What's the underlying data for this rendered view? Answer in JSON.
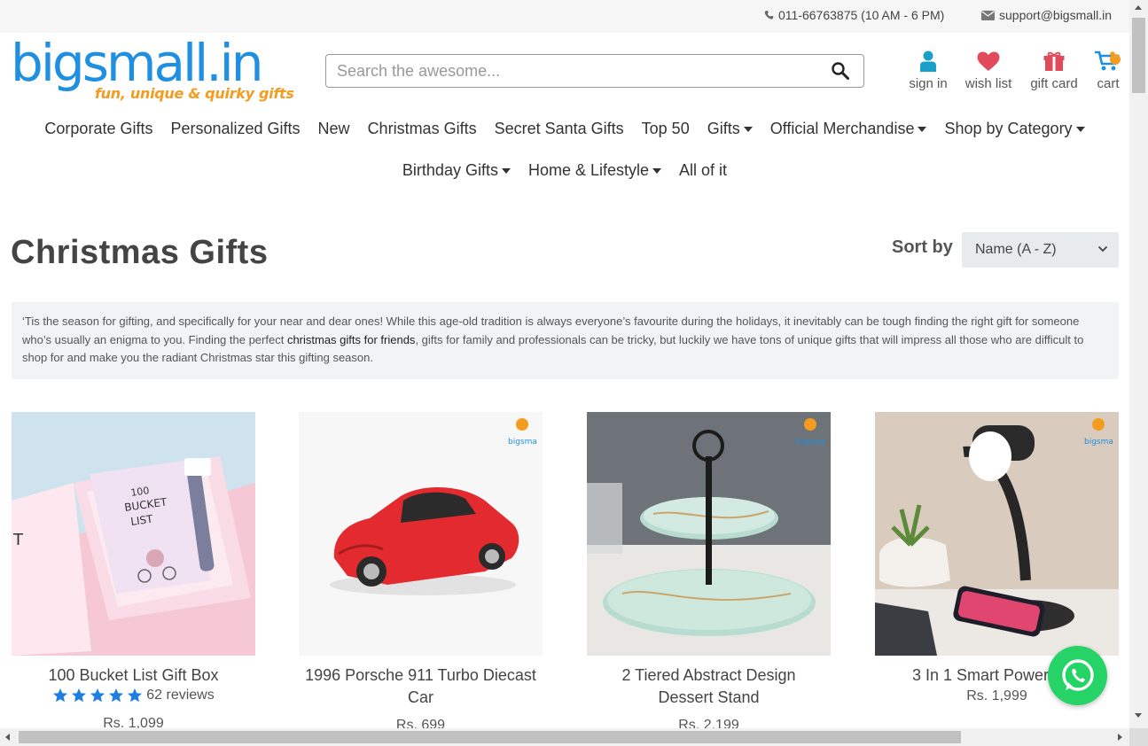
{
  "topbar": {
    "phone": "011-66763875 (10 AM - 6 PM)",
    "email": "support@bigsmall.in"
  },
  "logo": {
    "word": "bigsmall.in",
    "tagline": "fun, unique & quirky gifts"
  },
  "search": {
    "placeholder": "Search the awesome..."
  },
  "header_icons": [
    {
      "label": "sign in",
      "icon": "user-icon"
    },
    {
      "label": "wish list",
      "icon": "heart-icon"
    },
    {
      "label": "gift card",
      "icon": "gift-icon"
    },
    {
      "label": "cart",
      "icon": "cart-icon"
    }
  ],
  "nav_row1": [
    {
      "label": "Corporate Gifts",
      "dropdown": false
    },
    {
      "label": "Personalized Gifts",
      "dropdown": false
    },
    {
      "label": "New",
      "dropdown": false
    },
    {
      "label": "Christmas Gifts",
      "dropdown": false
    },
    {
      "label": "Secret Santa Gifts",
      "dropdown": false
    },
    {
      "label": "Top 50",
      "dropdown": false
    },
    {
      "label": "Gifts",
      "dropdown": true
    },
    {
      "label": "Official Merchandise",
      "dropdown": true
    },
    {
      "label": "Shop by Category",
      "dropdown": true
    }
  ],
  "nav_row2": [
    {
      "label": "Birthday Gifts",
      "dropdown": true
    },
    {
      "label": "Home & Lifestyle",
      "dropdown": true
    },
    {
      "label": "All of it",
      "dropdown": false
    }
  ],
  "page": {
    "title": "Christmas Gifts",
    "sort_label": "Sort by",
    "sort_value": "Name (A - Z)"
  },
  "description": {
    "part1": "‘Tis the season for gifting, and specifically for your near and dear ones! While this age-old tradition is always everyone’s favourite during the holidays, it inevitably can be tough finding the right gift for someone who’s usually an enigma to you. Finding the perfect ",
    "link": "christmas gifts for friends",
    "part2": ", gifts for family and professionals can be tricky, but luckily we have tons of unique gifts that will impress all those who are difficult to shop for and make you the radiant Christmas star this gifting season."
  },
  "products": [
    {
      "name": "100 Bucket List Gift Box",
      "reviews": "62 reviews",
      "stars": 5,
      "price": "Rs. 1,099"
    },
    {
      "name": "1996 Porsche 911 Turbo Diecast Car",
      "price": "Rs. 699"
    },
    {
      "name": "2 Tiered Abstract Design Dessert Stand",
      "price": "Rs. 2,199"
    },
    {
      "name": "3 In 1 Smart Power Sou",
      "price": "Rs. 1,999"
    }
  ],
  "colors": {
    "brand_blue": "#1e8fe1",
    "brand_orange": "#f39c1f",
    "star_blue": "#1e7fe0",
    "whatsapp_green": "#25d366"
  }
}
